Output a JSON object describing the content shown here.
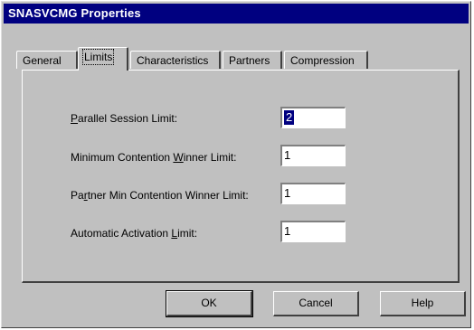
{
  "window": {
    "title": "SNASVCMG Properties"
  },
  "tabs": [
    {
      "label": "General",
      "active": false
    },
    {
      "label": "Limits",
      "active": true
    },
    {
      "label": "Characteristics",
      "active": false
    },
    {
      "label": "Partners",
      "active": false
    },
    {
      "label": "Compression",
      "active": false
    }
  ],
  "fields": [
    {
      "pre": "",
      "hot": "P",
      "post": "arallel Session Limit:",
      "value": "2",
      "selected": true
    },
    {
      "pre": "Minimum Contention ",
      "hot": "W",
      "post": "inner Limit:",
      "value": "1",
      "selected": false
    },
    {
      "pre": "Pa",
      "hot": "r",
      "post": "tner Min Contention Winner Limit:",
      "value": "1",
      "selected": false
    },
    {
      "pre": "Automatic Activation ",
      "hot": "L",
      "post": "imit:",
      "value": "1",
      "selected": false
    }
  ],
  "buttons": {
    "ok": "OK",
    "cancel": "Cancel",
    "help": "Help"
  },
  "icons": {
    "properties": "notepad-gear-icon",
    "pointer": "mouse-cursor-icon"
  },
  "colors": {
    "titlebar": "#000080",
    "face": "#c0c0c0",
    "selection": "#000080"
  }
}
